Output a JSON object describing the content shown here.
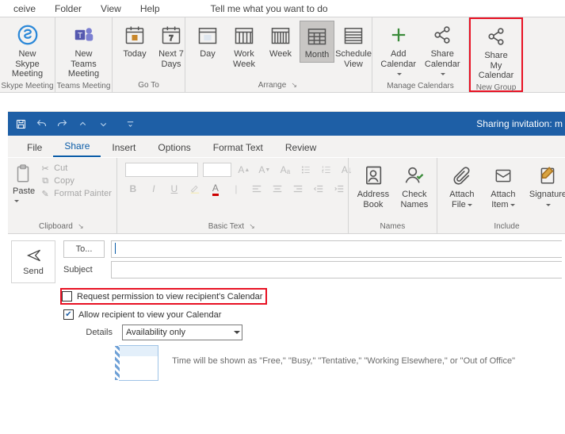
{
  "menu": {
    "m1": "ceive",
    "m2": "Folder",
    "m3": "View",
    "m4": "Help",
    "tell": "Tell me what you want to do"
  },
  "ribbon": {
    "g1": {
      "label": "Skype Meeting",
      "btn1": "New Skype\nMeeting"
    },
    "g2": {
      "label": "Teams Meeting",
      "btn1": "New Teams\nMeeting"
    },
    "g3": {
      "label": "Go To",
      "btn1": "Today",
      "btn2": "Next 7\nDays"
    },
    "g4": {
      "label": "Arrange",
      "btn1": "Day",
      "btn2": "Work\nWeek",
      "btn3": "Week",
      "btn4": "Month",
      "btn5": "Schedule\nView"
    },
    "g5": {
      "label": "Manage Calendars",
      "btn1": "Add\nCalendar",
      "btn2": "Share\nCalendar"
    },
    "g6": {
      "label": "New Group",
      "btn1": "Share My\nCalendar"
    }
  },
  "compose": {
    "title": "Sharing invitation: m",
    "tabs": {
      "file": "File",
      "share": "Share",
      "insert": "Insert",
      "options": "Options",
      "format": "Format Text",
      "review": "Review"
    },
    "clip": {
      "label": "Clipboard",
      "paste": "Paste",
      "cut": "Cut",
      "copy": "Copy",
      "painter": "Format Painter"
    },
    "basic": {
      "label": "Basic Text"
    },
    "names": {
      "label": "Names",
      "b1": "Address\nBook",
      "b2": "Check\nNames"
    },
    "include": {
      "label": "Include",
      "b1": "Attach\nFile",
      "b2": "Attach\nItem",
      "b3": "Signature"
    },
    "send": "Send",
    "to": "To...",
    "subject": "Subject",
    "opt1": "Request permission to view recipient's Calendar",
    "opt2": "Allow recipient to view your Calendar",
    "details_lbl": "Details",
    "details_val": "Availability only",
    "freebusy": "Time will be shown as \"Free,\" \"Busy,\" \"Tentative,\" \"Working Elsewhere,\" or \"Out of Office\""
  }
}
